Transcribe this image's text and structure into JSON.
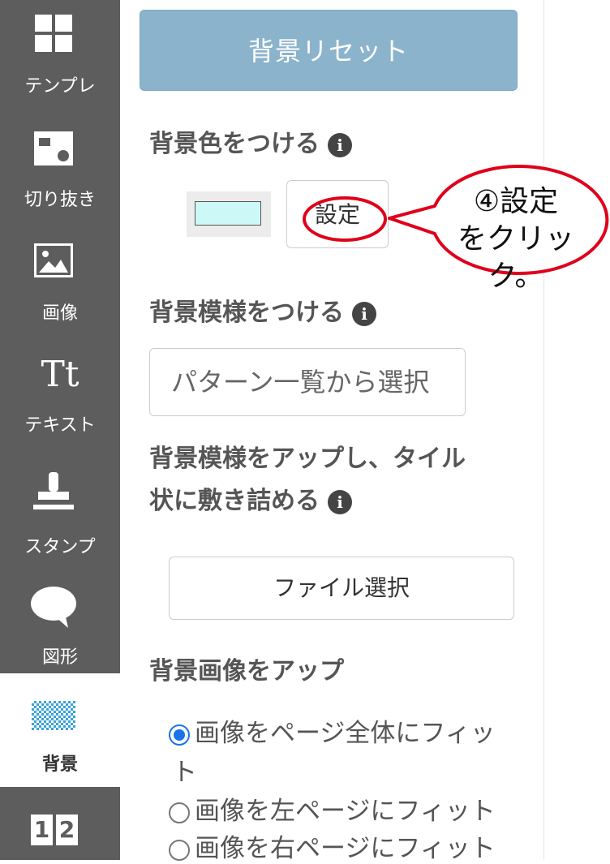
{
  "sidebar": {
    "items": [
      {
        "label": "テンプレ",
        "icon": "template-grid-icon"
      },
      {
        "label": "切り抜き",
        "icon": "crop-shape-icon"
      },
      {
        "label": "画像",
        "icon": "image-icon"
      },
      {
        "label": "テキスト",
        "icon": "text-icon",
        "glyph": "Tt"
      },
      {
        "label": "スタンプ",
        "icon": "stamp-icon"
      },
      {
        "label": "図形",
        "icon": "speech-bubble-icon"
      },
      {
        "label": "背景",
        "icon": "background-pattern-icon",
        "active": true
      },
      {
        "label": "",
        "icon": "page-numbers-icon",
        "glyph1": "1",
        "glyph2": "2"
      }
    ]
  },
  "panel": {
    "reset_button": "背景リセット",
    "bg_color": {
      "heading": "背景色をつける",
      "swatch_color": "#ccf8f8",
      "set_button": "設定"
    },
    "bg_pattern": {
      "heading": "背景模様をつける",
      "select_label": "パターン一覧から選択"
    },
    "tile_upload": {
      "heading_line1": "背景模様をアップし、タイル",
      "heading_line2": "状に敷き詰める",
      "file_button": "ファイル選択"
    },
    "bg_image": {
      "heading": "背景画像をアップ",
      "options": [
        {
          "label_line1": "画像をページ全体にフィッ",
          "label_line2": "ト",
          "checked": true
        },
        {
          "label_line1": "画像を左ページにフィット",
          "checked": false
        },
        {
          "label_line1": "画像を右ページにフィット",
          "checked": false
        }
      ]
    },
    "info_glyph": "i"
  },
  "callout": {
    "line1": "④設定",
    "line2": "をクリック。",
    "stroke_color": "#e0001a"
  }
}
